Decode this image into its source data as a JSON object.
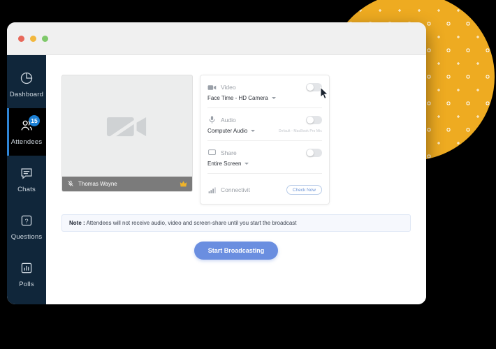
{
  "window": {
    "traffic_lights": [
      {
        "name": "close",
        "color": "#e8685a"
      },
      {
        "name": "minimize",
        "color": "#f2b73d"
      },
      {
        "name": "maximize",
        "color": "#7fc96a"
      }
    ]
  },
  "sidebar": {
    "items": [
      {
        "label": "Dashboard",
        "icon": "pie-chart-icon",
        "active": false,
        "badge": null
      },
      {
        "label": "Attendees",
        "icon": "people-icon",
        "active": true,
        "badge": "15"
      },
      {
        "label": "Chats",
        "icon": "chat-bubble-icon",
        "active": false,
        "badge": null
      },
      {
        "label": "Questions",
        "icon": "question-box-icon",
        "active": false,
        "badge": null
      },
      {
        "label": "Polls",
        "icon": "bar-chart-icon",
        "active": false,
        "badge": null
      }
    ]
  },
  "video_preview": {
    "placeholder_icon": "camera-off-icon",
    "participant_name": "Thomas Wayne",
    "mic_icon": "mic-muted-icon",
    "host_icon": "crown-icon"
  },
  "settings": {
    "rows": [
      {
        "label": "Video",
        "icon": "video-camera-icon",
        "value": "Face Time - HD Camera",
        "hint": "",
        "toggle_on": false,
        "has_toggle": true
      },
      {
        "label": "Audio",
        "icon": "microphone-icon",
        "value": "Computer Audio",
        "hint": "Default - MacBook Pro Mic",
        "toggle_on": false,
        "has_toggle": true
      },
      {
        "label": "Share",
        "icon": "monitor-icon",
        "value": "Entire Screen",
        "hint": "",
        "toggle_on": false,
        "has_toggle": true
      }
    ],
    "connectivity": {
      "label": "Connectivit",
      "icon": "signal-bars-icon",
      "button_label": "Check Now"
    }
  },
  "note": {
    "prefix": "Note :",
    "text": "Attendees will not receive audio, video and screen-share until you start the broadcast"
  },
  "broadcast": {
    "label": "Start Broadcasting",
    "color": "#6a8ee0"
  },
  "decor": {
    "circle_color": "#eeab21"
  }
}
